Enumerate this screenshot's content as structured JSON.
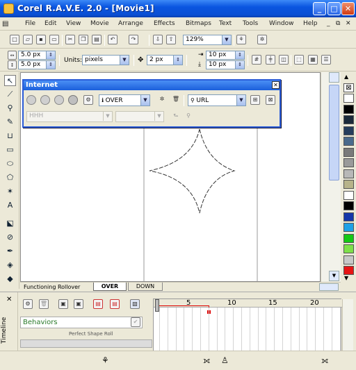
{
  "window": {
    "title": "Corel R.A.V.E. 2.0 - [Movie1]",
    "min_label": "_",
    "max_label": "□",
    "close_label": "✕"
  },
  "menu": [
    "File",
    "Edit",
    "View",
    "Movie",
    "Arrange",
    "Effects",
    "Bitmaps",
    "Text",
    "Tools",
    "Window",
    "Help"
  ],
  "toolbar": {
    "zoom": "129%"
  },
  "propbar": {
    "width": "5.0 px",
    "height": "5.0 px",
    "units_label": "Units:",
    "units_value": "pixels",
    "nudge": "2 px",
    "dup_x": "10 px",
    "dup_y": "10 px"
  },
  "internet_toolbar": {
    "title": "Internet",
    "state_value": "OVER",
    "url_label": "URL",
    "disabled_field1": "HHH"
  },
  "tabs": {
    "layer_name": "Functioning Rollover",
    "tab_over": "OVER",
    "tab_down": "DOWN"
  },
  "timeline": {
    "side_label": "Timeline",
    "close_glyph": "✕",
    "behaviors_label": "Behaviors",
    "object_row": "Perfect Shape Roll",
    "frame_numbers": [
      "5",
      "10",
      "15",
      "20"
    ]
  },
  "palette_colors": [
    "#ffffff",
    "#000000",
    "#1b2a3a",
    "#253d5c",
    "#4a6a8c",
    "#7a7a7a",
    "#9a9a9a",
    "#b8b8b8",
    "#b7b38a",
    "#ffffff",
    "#000000",
    "#1436a8",
    "#1da0e6",
    "#14c814",
    "#7ee04a",
    "#c8c8c8",
    "#e61414"
  ],
  "icons": {
    "pick_tool": "pick-tool-icon",
    "shape_tool": "shape-tool-icon",
    "zoom_tool": "zoom-tool-icon"
  }
}
